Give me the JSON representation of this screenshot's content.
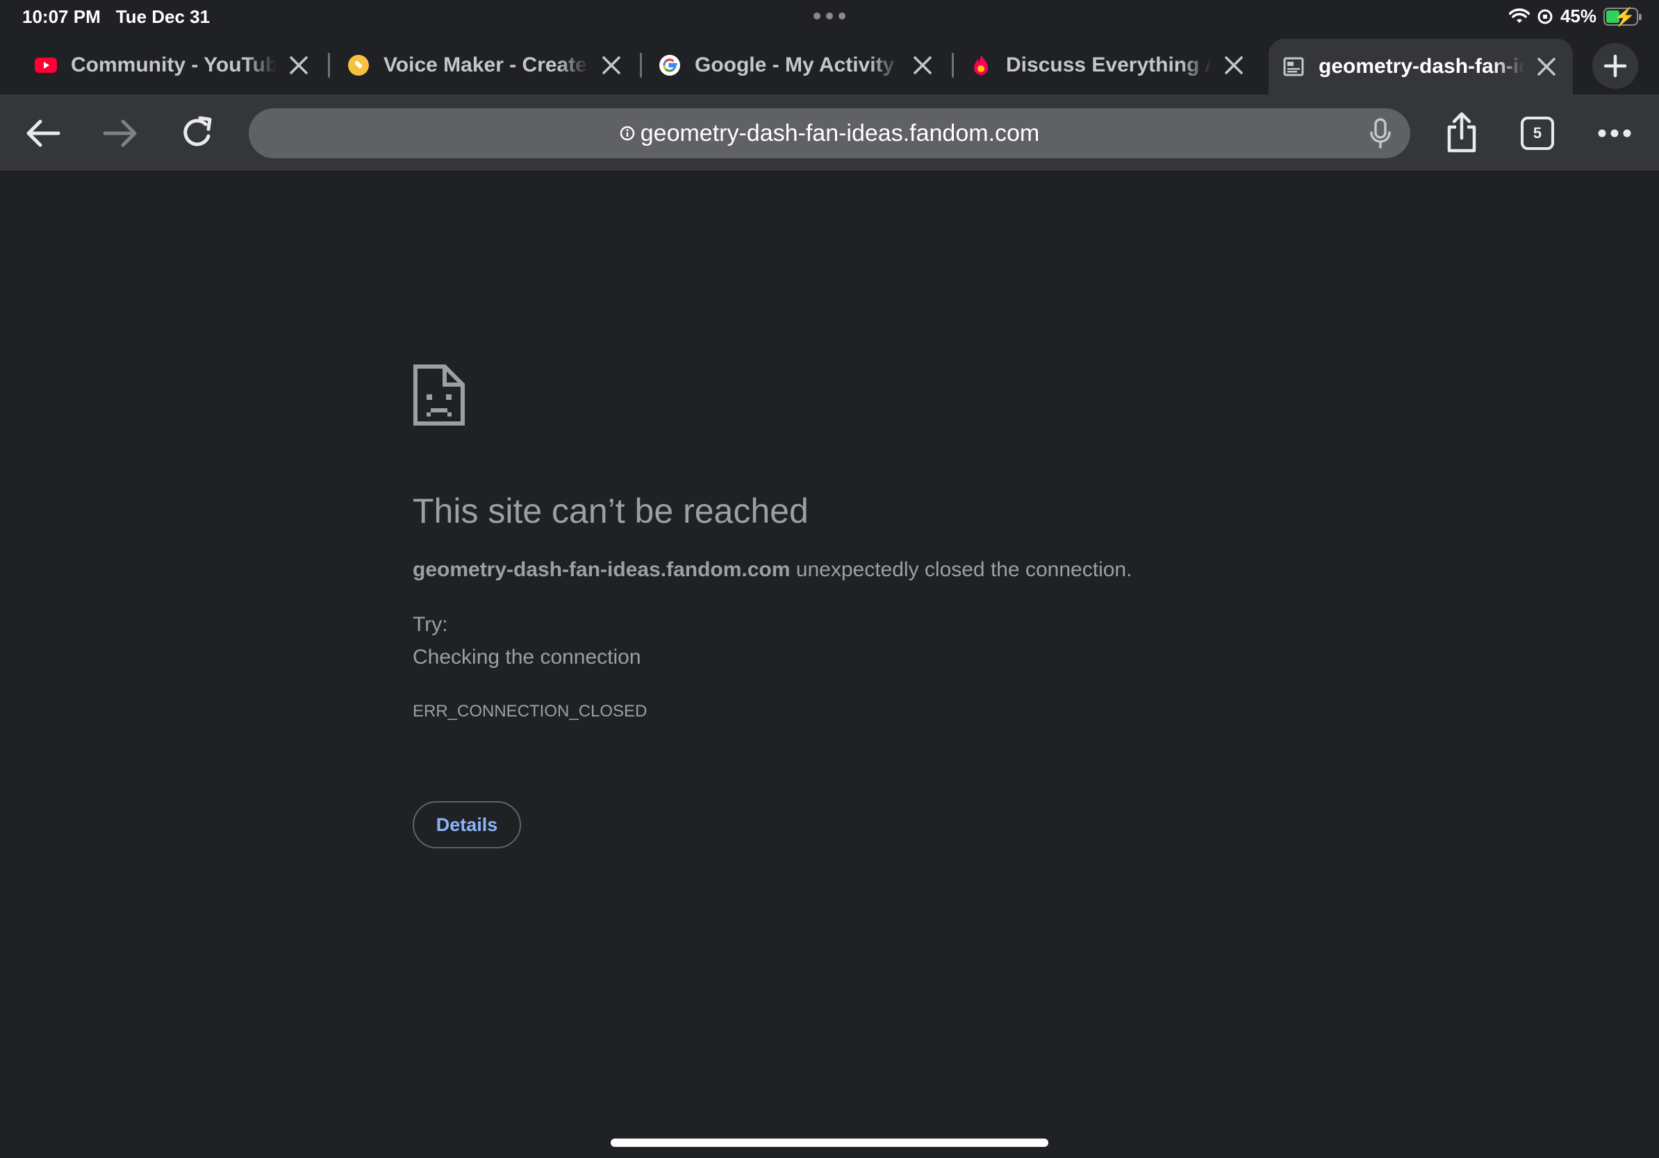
{
  "status_bar": {
    "time": "10:07 PM",
    "date": "Tue Dec 31",
    "battery_text": "45%",
    "battery_level": 0.45
  },
  "tabs": [
    {
      "title": "Community - YouTube",
      "favicon": "youtube-icon"
    },
    {
      "title": "Voice Maker - Create",
      "favicon": "voice-maker-icon"
    },
    {
      "title": "Google - My Activity",
      "favicon": "google-icon"
    },
    {
      "title": "Discuss Everything About",
      "favicon": "fandom-icon"
    },
    {
      "title": "geometry-dash-fan-ideas",
      "favicon": "page-icon",
      "active": true
    }
  ],
  "toolbar": {
    "url": "geometry-dash-fan-ideas.fandom.com",
    "tab_count": "5"
  },
  "error": {
    "title": "This site can’t be reached",
    "host": "geometry-dash-fan-ideas.fandom.com",
    "message": " unexpectedly closed the connection.",
    "try_label": "Try:",
    "suggestion": "Checking the connection",
    "code": "ERR_CONNECTION_CLOSED",
    "details_label": "Details"
  },
  "colors": {
    "background": "#202124",
    "toolbar": "#35363a",
    "omnibox": "#5f6165",
    "link": "#8ab4f8",
    "muted_text": "#9aa0a6"
  }
}
